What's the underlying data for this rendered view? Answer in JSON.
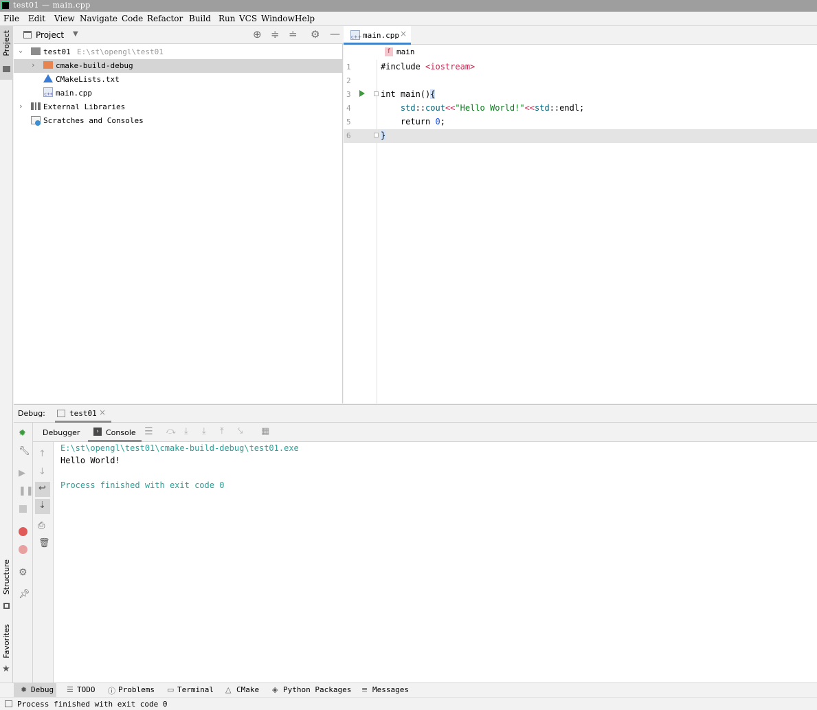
{
  "window": {
    "title": "test01 — main.cpp"
  },
  "menu": [
    "File",
    "Edit",
    "View",
    "Navigate",
    "Code",
    "Refactor",
    "Build",
    "Run",
    "VCS",
    "Window",
    "Help"
  ],
  "left_strip": {
    "project_label": "Project",
    "structure_label": "Structure",
    "favorites_label": "Favorites"
  },
  "project": {
    "view_label": "Project",
    "root_name": "test01",
    "root_path": "E:\\st\\opengl\\test01",
    "items": [
      "cmake-build-debug",
      "CMakeLists.txt",
      "main.cpp",
      "External Libraries",
      "Scratches and Consoles"
    ]
  },
  "editor": {
    "tab_label": "main.cpp",
    "breadcrumb": "main",
    "breadcrumb_badge": "f",
    "line_numbers": [
      "1",
      "2",
      "3",
      "4",
      "5",
      "6"
    ]
  },
  "debug": {
    "label": "Debug:",
    "session_tab": "test01",
    "tab_debugger": "Debugger",
    "tab_console": "Console",
    "console_lines": [
      "E:\\st\\opengl\\test01\\cmake-build-debug\\test01.exe",
      "Hello World!",
      "Process finished with exit code 0"
    ]
  },
  "bottom_tabs": [
    "Debug",
    "TODO",
    "Problems",
    "Terminal",
    "CMake",
    "Python Packages",
    "Messages"
  ],
  "status": {
    "text": "Process finished with exit code 0"
  },
  "colors": {
    "accent_green": "#21d789",
    "console_path": "#2aa198",
    "selection": "#d5d5d5",
    "string_green": "#067d17"
  }
}
